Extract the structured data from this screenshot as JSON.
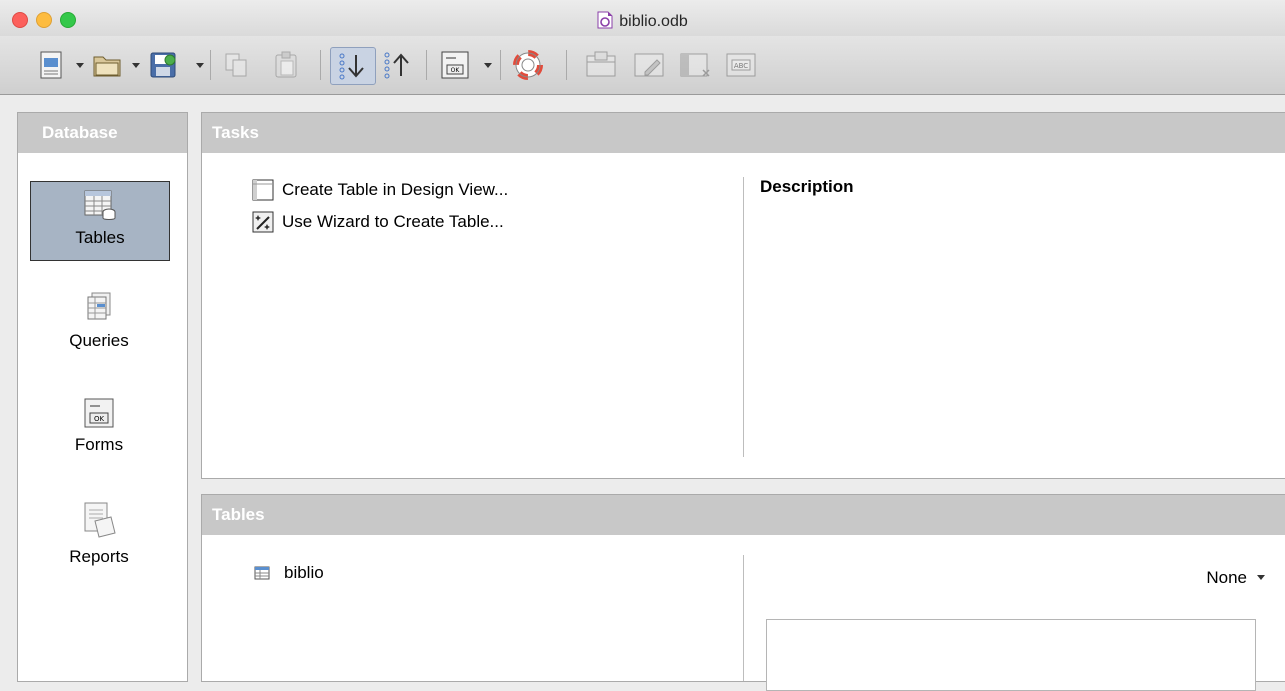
{
  "window": {
    "title": "biblio.odb"
  },
  "toolbar": {
    "buttons": [
      "new-document-icon",
      "open-folder-icon",
      "save-icon",
      "copy-icon",
      "paste-icon",
      "sort-ascending-icon",
      "sort-descending-icon",
      "form-icon",
      "help-icon",
      "open-object-icon",
      "edit-object-icon",
      "delete-object-icon",
      "rename-object-icon"
    ]
  },
  "sidebar": {
    "header": "Database",
    "items": [
      {
        "label": "Tables",
        "icon": "tables-icon",
        "active": true
      },
      {
        "label": "Queries",
        "icon": "queries-icon"
      },
      {
        "label": "Forms",
        "icon": "forms-icon"
      },
      {
        "label": "Reports",
        "icon": "reports-icon"
      }
    ]
  },
  "tasks": {
    "header": "Tasks",
    "items": [
      {
        "label": "Create Table in Design View...",
        "icon": "design-view-icon"
      },
      {
        "label": "Use Wizard to Create Table...",
        "icon": "wizard-icon"
      }
    ],
    "description_label": "Description"
  },
  "tables": {
    "header": "Tables",
    "items": [
      {
        "label": "biblio",
        "icon": "table-icon"
      }
    ],
    "preview_select": "None"
  },
  "colors": {
    "panel_header": "#c8c8c8",
    "selection": "#a7b4c4"
  }
}
